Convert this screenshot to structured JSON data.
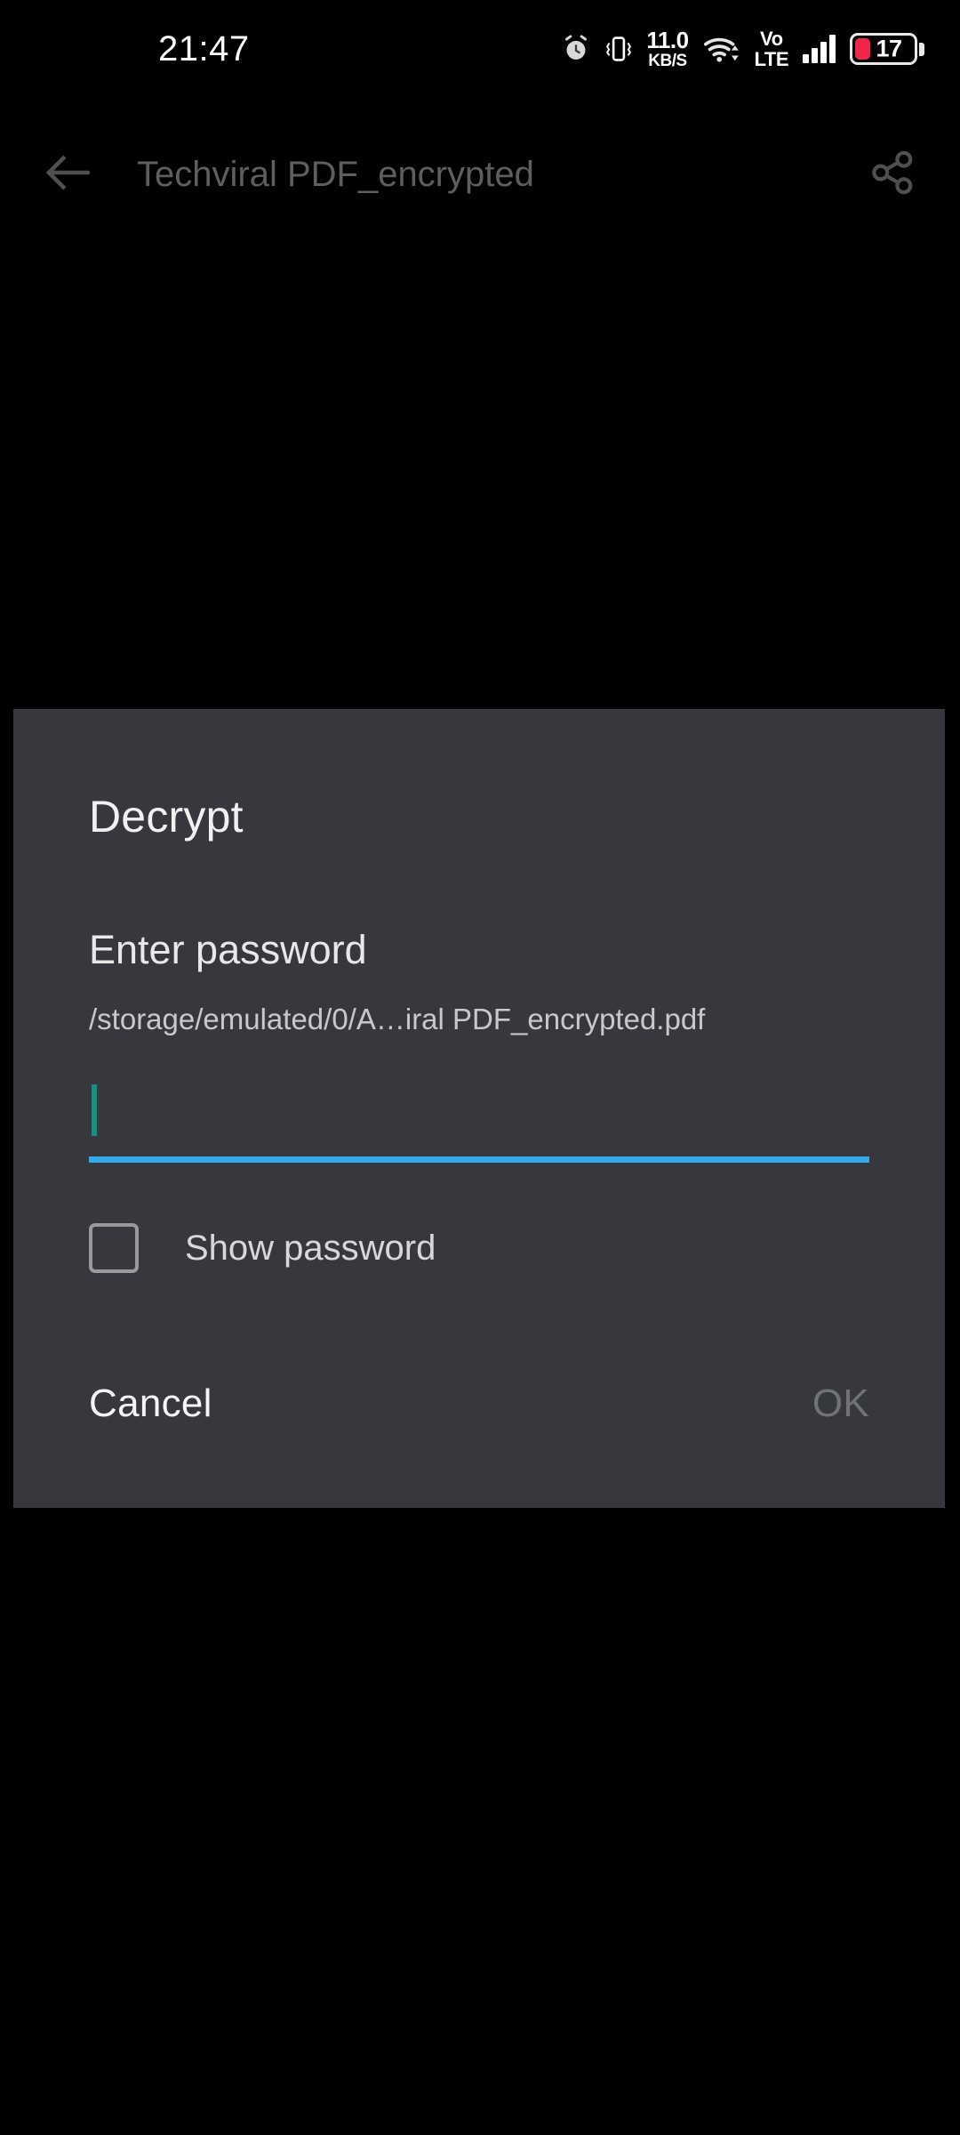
{
  "status_bar": {
    "clock": "21:47",
    "icons": [
      {
        "name": "alarm-icon",
        "label": "alarm"
      },
      {
        "name": "vibrate-icon",
        "label": "vibrate"
      },
      {
        "name": "network-speed-indicator",
        "label": "network speed"
      },
      {
        "name": "wifi-icon",
        "label": "wifi"
      },
      {
        "name": "volte-icon",
        "label": "VoLTE"
      },
      {
        "name": "signal-icon",
        "label": "signal"
      },
      {
        "name": "battery-icon",
        "label": "battery"
      }
    ],
    "network_speed": {
      "value": "11.0",
      "unit": "KB/S"
    },
    "volte": {
      "top": "Vo",
      "bottom": "LTE"
    },
    "battery": {
      "percent": "17"
    }
  },
  "toolbar": {
    "back_icon": "arrow-left-icon",
    "title": "Techviral PDF_encrypted",
    "share_icon": "share-icon"
  },
  "dialog": {
    "title": "Decrypt",
    "message": "Enter password",
    "file_path": "/storage/emulated/0/A…iral PDF_encrypted.pdf",
    "password_input": {
      "value": "",
      "placeholder": ""
    },
    "show_password": {
      "label": "Show password",
      "checked": false
    },
    "cancel_label": "Cancel",
    "ok_label": "OK"
  },
  "colors": {
    "screen_background": "#000000",
    "dialog_background": "#36383d",
    "accent_underline": "#33a9ec",
    "caret": "#17917f",
    "battery_low": "#f0264a",
    "toolbar_title": "#5e5e5e",
    "disabled_text": "#6f7277"
  }
}
